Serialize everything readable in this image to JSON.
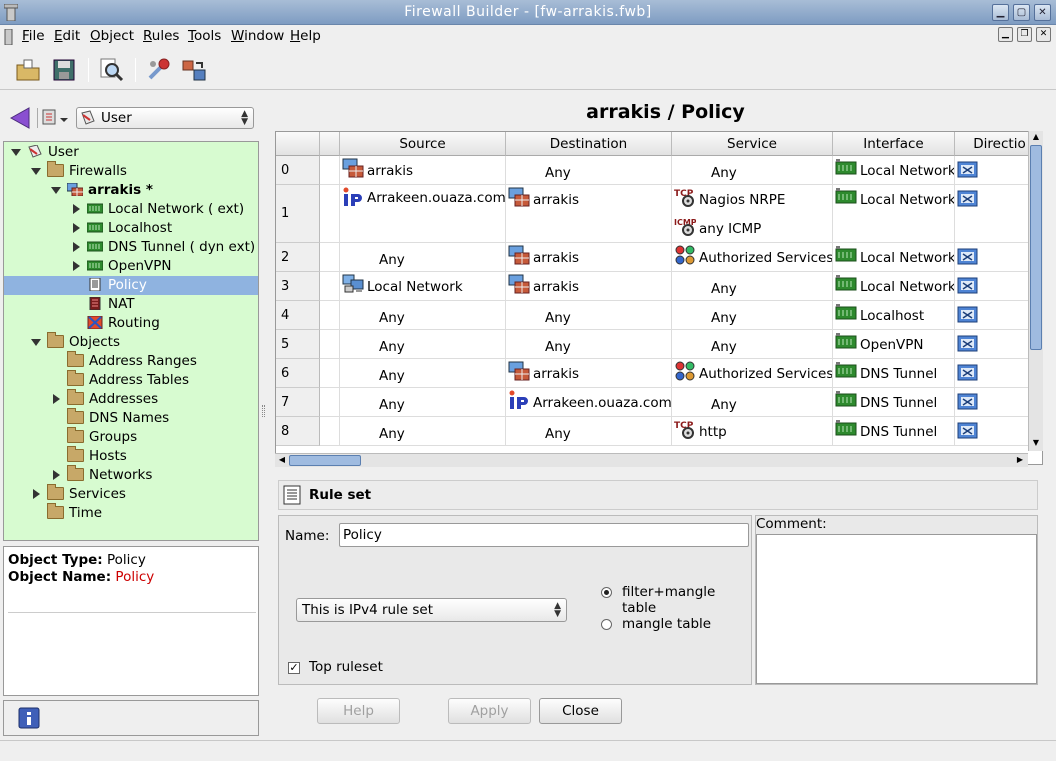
{
  "window": {
    "title": "Firewall Builder  - [fw-arrakis.fwb]"
  },
  "menu": [
    "File",
    "Edit",
    "Object",
    "Rules",
    "Tools",
    "Window",
    "Help"
  ],
  "left": {
    "library_combo": "User",
    "tree": [
      {
        "label": "User",
        "depth": 0,
        "exp": "down",
        "icon": "library-icon"
      },
      {
        "label": "Firewalls",
        "depth": 1,
        "exp": "down",
        "icon": "folder-icon"
      },
      {
        "label": "arrakis *",
        "depth": 2,
        "exp": "down",
        "icon": "firewall-icon",
        "bold": true
      },
      {
        "label": "Local Network ( ext)",
        "depth": 3,
        "exp": "right",
        "icon": "interface-icon"
      },
      {
        "label": "Localhost",
        "depth": 3,
        "exp": "right",
        "icon": "interface-icon"
      },
      {
        "label": "DNS Tunnel ( dyn ext)",
        "depth": 3,
        "exp": "right",
        "icon": "interface-icon"
      },
      {
        "label": "OpenVPN",
        "depth": 3,
        "exp": "right",
        "icon": "interface-icon"
      },
      {
        "label": "Policy",
        "depth": 3,
        "exp": "",
        "icon": "policy-icon",
        "selected": true
      },
      {
        "label": "NAT",
        "depth": 3,
        "exp": "",
        "icon": "nat-icon"
      },
      {
        "label": "Routing",
        "depth": 3,
        "exp": "",
        "icon": "routing-icon"
      },
      {
        "label": "Objects",
        "depth": 1,
        "exp": "down",
        "icon": "folder-icon"
      },
      {
        "label": "Address Ranges",
        "depth": 2,
        "exp": "",
        "icon": "folder-icon"
      },
      {
        "label": "Address Tables",
        "depth": 2,
        "exp": "",
        "icon": "folder-icon"
      },
      {
        "label": "Addresses",
        "depth": 2,
        "exp": "right",
        "icon": "folder-icon"
      },
      {
        "label": "DNS Names",
        "depth": 2,
        "exp": "",
        "icon": "folder-icon"
      },
      {
        "label": "Groups",
        "depth": 2,
        "exp": "",
        "icon": "folder-icon"
      },
      {
        "label": "Hosts",
        "depth": 2,
        "exp": "",
        "icon": "folder-icon"
      },
      {
        "label": "Networks",
        "depth": 2,
        "exp": "right",
        "icon": "folder-icon"
      },
      {
        "label": "Services",
        "depth": 1,
        "exp": "right",
        "icon": "folder-icon"
      },
      {
        "label": "Time",
        "depth": 1,
        "exp": "",
        "icon": "folder-icon"
      }
    ],
    "info": {
      "type_label": "Object Type:",
      "type_value": "Policy",
      "name_label": "Object Name:",
      "name_value": "Policy"
    }
  },
  "policy": {
    "title": "arrakis / Policy",
    "columns": [
      "Source",
      "Destination",
      "Service",
      "Interface",
      "Directio"
    ],
    "rows": [
      {
        "num": "0",
        "source": [
          {
            "t": "arrakis",
            "i": "firewall"
          }
        ],
        "dest": [
          {
            "t": "Any"
          }
        ],
        "service": [
          {
            "t": "Any"
          }
        ],
        "iface": [
          {
            "t": "Local Network",
            "i": "interface"
          }
        ]
      },
      {
        "num": "1",
        "source": [
          {
            "t": "Arrakeen.ouaza.com",
            "i": "ip"
          }
        ],
        "dest": [
          {
            "t": "arrakis",
            "i": "firewall"
          }
        ],
        "service": [
          {
            "t": "Nagios NRPE",
            "i": "tcp"
          },
          {
            "t": "any ICMP",
            "i": "icmp"
          }
        ],
        "iface": [
          {
            "t": "Local Network",
            "i": "interface"
          }
        ]
      },
      {
        "num": "2",
        "source": [
          {
            "t": "Any"
          }
        ],
        "dest": [
          {
            "t": "arrakis",
            "i": "firewall"
          }
        ],
        "service": [
          {
            "t": "Authorized Services",
            "i": "group"
          }
        ],
        "iface": [
          {
            "t": "Local Network",
            "i": "interface"
          }
        ]
      },
      {
        "num": "3",
        "source": [
          {
            "t": "Local Network",
            "i": "network"
          }
        ],
        "dest": [
          {
            "t": "arrakis",
            "i": "firewall"
          }
        ],
        "service": [
          {
            "t": "Any"
          }
        ],
        "iface": [
          {
            "t": "Local Network",
            "i": "interface"
          }
        ]
      },
      {
        "num": "4",
        "source": [
          {
            "t": "Any"
          }
        ],
        "dest": [
          {
            "t": "Any"
          }
        ],
        "service": [
          {
            "t": "Any"
          }
        ],
        "iface": [
          {
            "t": "Localhost",
            "i": "interface"
          }
        ]
      },
      {
        "num": "5",
        "source": [
          {
            "t": "Any"
          }
        ],
        "dest": [
          {
            "t": "Any"
          }
        ],
        "service": [
          {
            "t": "Any"
          }
        ],
        "iface": [
          {
            "t": "OpenVPN",
            "i": "interface"
          }
        ]
      },
      {
        "num": "6",
        "source": [
          {
            "t": "Any"
          }
        ],
        "dest": [
          {
            "t": "arrakis",
            "i": "firewall"
          }
        ],
        "service": [
          {
            "t": "Authorized Services",
            "i": "group"
          }
        ],
        "iface": [
          {
            "t": "DNS Tunnel",
            "i": "interface"
          }
        ]
      },
      {
        "num": "7",
        "source": [
          {
            "t": "Any"
          }
        ],
        "dest": [
          {
            "t": "Arrakeen.ouaza.com",
            "i": "ip"
          }
        ],
        "service": [
          {
            "t": "Any"
          }
        ],
        "iface": [
          {
            "t": "DNS Tunnel",
            "i": "interface"
          }
        ]
      },
      {
        "num": "8",
        "source": [
          {
            "t": "Any"
          }
        ],
        "dest": [
          {
            "t": "Any"
          }
        ],
        "service": [
          {
            "t": "http",
            "i": "tcp"
          }
        ],
        "iface": [
          {
            "t": "DNS Tunnel",
            "i": "interface"
          }
        ]
      }
    ]
  },
  "ruleset": {
    "header": "Rule set",
    "name_label": "Name:",
    "name_value": "Policy",
    "comment_label": "Comment:",
    "ipver": "This is IPv4 rule set",
    "radio_filter": "filter+mangle table",
    "radio_mangle": "mangle table",
    "top_ruleset": "Top ruleset"
  },
  "buttons": {
    "help": "Help",
    "apply": "Apply",
    "close": "Close"
  },
  "colors": {
    "tree_bg": "#d7fbd0",
    "selection": "#8fb3e0",
    "info_value": "#cc0000",
    "titlebar": "#8aa6c9"
  }
}
